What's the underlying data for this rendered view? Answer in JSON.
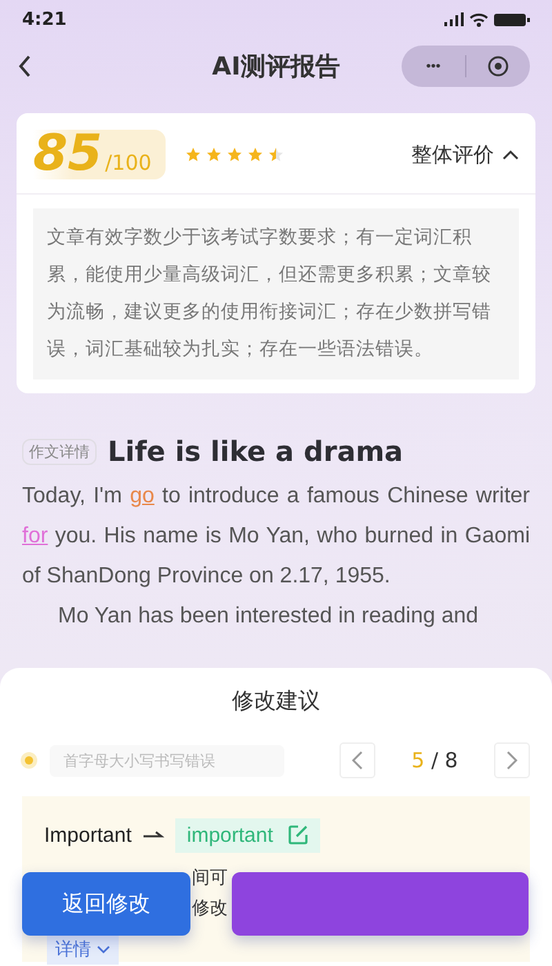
{
  "status_bar": {
    "time": "4:21"
  },
  "header": {
    "title": "AI测评报告",
    "more": "•••"
  },
  "score_card": {
    "score": "85",
    "total": "/100",
    "stars": 4.5,
    "overall_label": "整体评价",
    "expanded": true,
    "comment": "文章有效字数少于该考试字数要求；有一定词汇积累，能使用少量高级词汇，但还需更多积累；文章较为流畅，建议更多的使用衔接词汇；存在少数拼写错误，词汇基础较为扎实；存在一些语法错误。"
  },
  "essay": {
    "tag": "作文详情",
    "title": "Life is like a drama",
    "paragraphs": [
      [
        {
          "text": "Today, I'm "
        },
        {
          "text": "go",
          "color": "#e8884a"
        },
        {
          "text": " to introduce a famous Chinese writer "
        },
        {
          "text": "for",
          "color": "#e070d8"
        },
        {
          "text": " you. His name is Mo Yan, who burned in Gaomi of ShanDong Province on 2.17, 1955."
        }
      ],
      [
        {
          "text": "Mo Yan has been interested in reading and"
        }
      ]
    ]
  },
  "suggestions": {
    "title": "修改建议",
    "category": "首字母大小写书写错误",
    "current": "5",
    "total": "/ 8",
    "original": "Important",
    "corrected": "important",
    "fragments": [
      "间可",
      "修改"
    ],
    "details": "详情",
    "buttons": [
      {
        "label": "返回修改",
        "kind": "primary"
      },
      {
        "kind": "secondary"
      }
    ]
  }
}
